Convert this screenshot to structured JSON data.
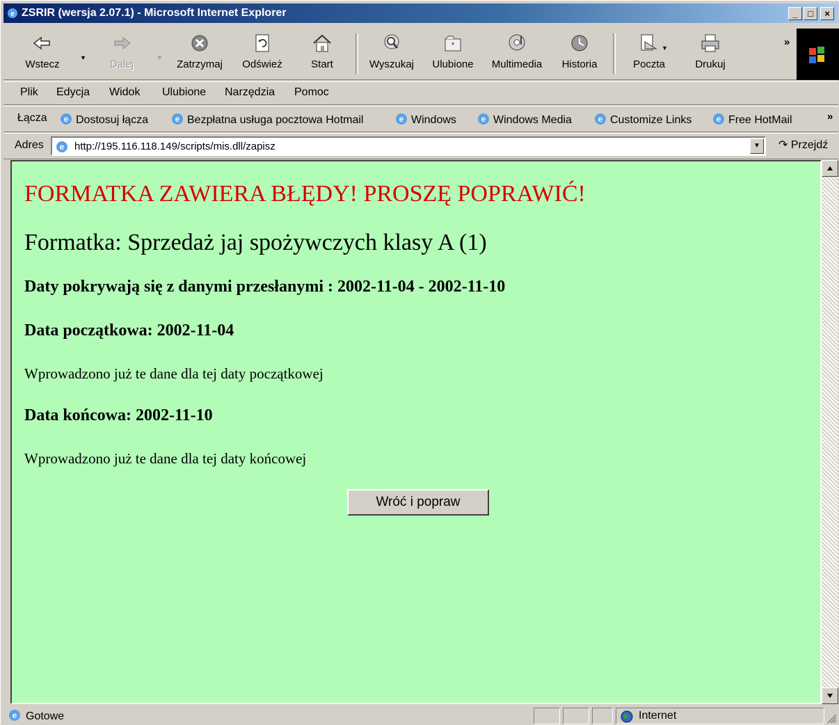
{
  "window": {
    "title": "ZSRIR (wersja 2.07.1) - Microsoft Internet Explorer",
    "controls": {
      "minimize": "_",
      "maximize": "□",
      "close": "×"
    }
  },
  "toolbar": {
    "buttons": [
      {
        "label": "Wstecz",
        "icon": "back-arrow-icon",
        "enabled": true
      },
      {
        "label": "Dalej",
        "icon": "forward-arrow-icon",
        "enabled": false
      },
      {
        "label": "Zatrzymaj",
        "icon": "stop-icon",
        "enabled": true
      },
      {
        "label": "Odśwież",
        "icon": "refresh-icon",
        "enabled": true
      },
      {
        "label": "Start",
        "icon": "home-icon",
        "enabled": true
      },
      {
        "label": "Wyszukaj",
        "icon": "search-icon",
        "enabled": true
      },
      {
        "label": "Ulubione",
        "icon": "favorites-icon",
        "enabled": true
      },
      {
        "label": "Multimedia",
        "icon": "media-icon",
        "enabled": true
      },
      {
        "label": "Historia",
        "icon": "history-icon",
        "enabled": true
      },
      {
        "label": "Poczta",
        "icon": "mail-icon",
        "enabled": true
      },
      {
        "label": "Drukuj",
        "icon": "print-icon",
        "enabled": true
      }
    ],
    "more": "»"
  },
  "menu": [
    "Plik",
    "Edycja",
    "Widok",
    "Ulubione",
    "Narzędzia",
    "Pomoc"
  ],
  "links_bar": {
    "title": "Łącza",
    "items": [
      "Dostosuj łącza",
      "Bezpłatna usługa pocztowa Hotmail",
      "Windows",
      "Windows Media",
      "Customize Links",
      "Free HotMail"
    ],
    "more": "»"
  },
  "address_bar": {
    "label": "Adres",
    "url": "http://195.116.118.149/scripts/mis.dll/zapisz",
    "go_label": "Przejdź"
  },
  "page": {
    "error_title": "FORMATKA ZAWIERA BŁĘDY! PROSZĘ POPRAWIĆ!",
    "form_title": "Formatka: Sprzedaż jaj spożywczych klasy A (1)",
    "overlap_heading": "Daty pokrywają się z danymi przesłanymi : 2002-11-04 - 2002-11-10",
    "start_heading": "Data początkowa: 2002-11-04",
    "start_message": "Wprowadzono już te dane dla tej daty początkowej",
    "end_heading": "Data końcowa: 2002-11-10",
    "end_message": "Wprowadzono już te dane dla tej daty końcowej",
    "back_button": "Wróć i popraw",
    "background_color": "#b3fcb8",
    "error_color": "#d80000"
  },
  "status_bar": {
    "text": "Gotowe",
    "zone": "Internet"
  }
}
